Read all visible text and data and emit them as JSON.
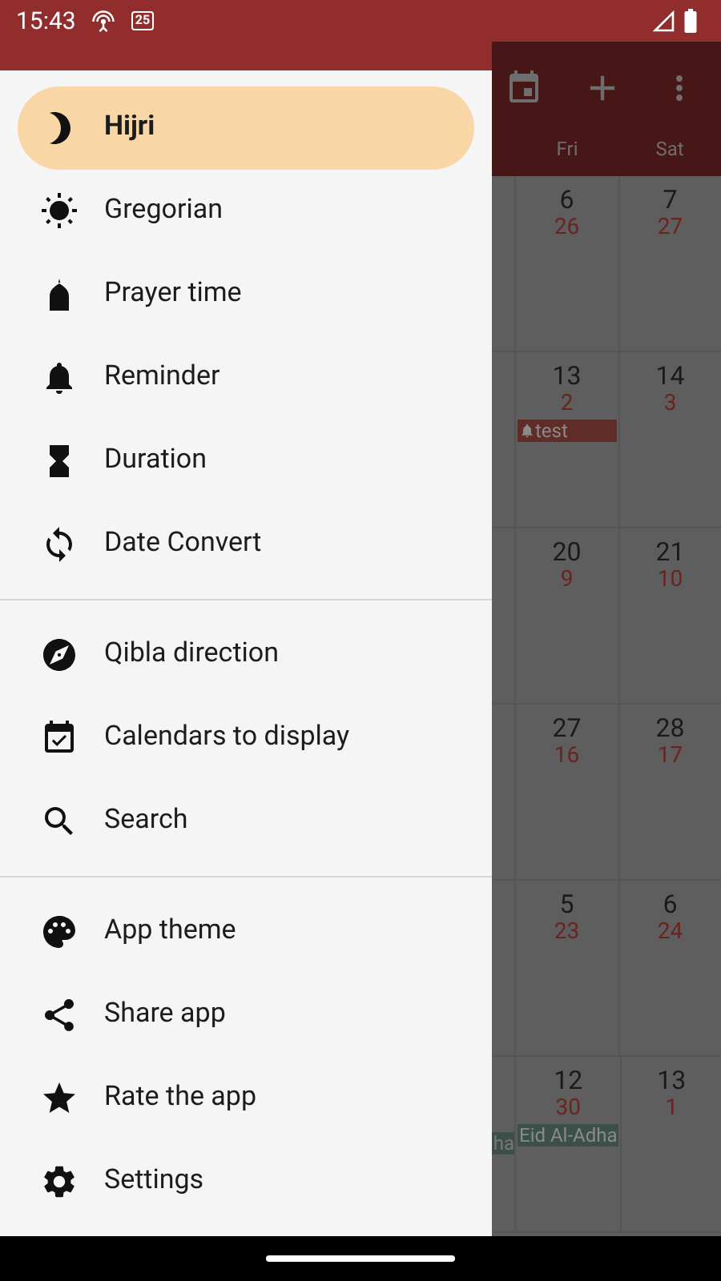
{
  "status_bar": {
    "time": "15:43",
    "calendar_icon_day": "25"
  },
  "drawer": {
    "sections": [
      {
        "items": [
          {
            "label": "Hijri",
            "selected": true
          },
          {
            "label": "Gregorian",
            "selected": false
          },
          {
            "label": "Prayer time",
            "selected": false
          },
          {
            "label": "Reminder",
            "selected": false
          },
          {
            "label": "Duration",
            "selected": false
          },
          {
            "label": "Date Convert",
            "selected": false
          }
        ]
      },
      {
        "items": [
          {
            "label": "Qibla direction",
            "selected": false
          },
          {
            "label": "Calendars to display",
            "selected": false
          },
          {
            "label": "Search",
            "selected": false
          }
        ]
      },
      {
        "items": [
          {
            "label": "App theme",
            "selected": false
          },
          {
            "label": "Share app",
            "selected": false
          },
          {
            "label": "Rate the app",
            "selected": false
          },
          {
            "label": "Settings",
            "selected": false
          }
        ]
      }
    ]
  },
  "calendar": {
    "day_names": [
      "Fri",
      "Sat"
    ],
    "weeks": [
      {
        "cells": [
          {
            "day": "6",
            "hijri": "26"
          },
          {
            "day": "7",
            "hijri": "27"
          }
        ]
      },
      {
        "cells": [
          {
            "day": "13",
            "hijri": "2",
            "events": [
              {
                "label": "test",
                "kind": "reminder",
                "color": "#602c27"
              }
            ]
          },
          {
            "day": "14",
            "hijri": "3"
          }
        ]
      },
      {
        "cells": [
          {
            "day": "20",
            "hijri": "9"
          },
          {
            "day": "21",
            "hijri": "10"
          }
        ]
      },
      {
        "cells": [
          {
            "day": "27",
            "hijri": "16"
          },
          {
            "day": "28",
            "hijri": "17"
          }
        ]
      },
      {
        "cells": [
          {
            "day": "5",
            "hijri": "23"
          },
          {
            "day": "6",
            "hijri": "24"
          }
        ]
      },
      {
        "partial_event": {
          "label": "ha",
          "color": "#3c5048"
        },
        "cells": [
          {
            "day": "12",
            "hijri": "30",
            "events": [
              {
                "label": "Eid Al-Adha",
                "kind": "holiday",
                "color": "#3c5048"
              }
            ]
          },
          {
            "day": "13",
            "hijri": "1"
          }
        ]
      }
    ]
  }
}
